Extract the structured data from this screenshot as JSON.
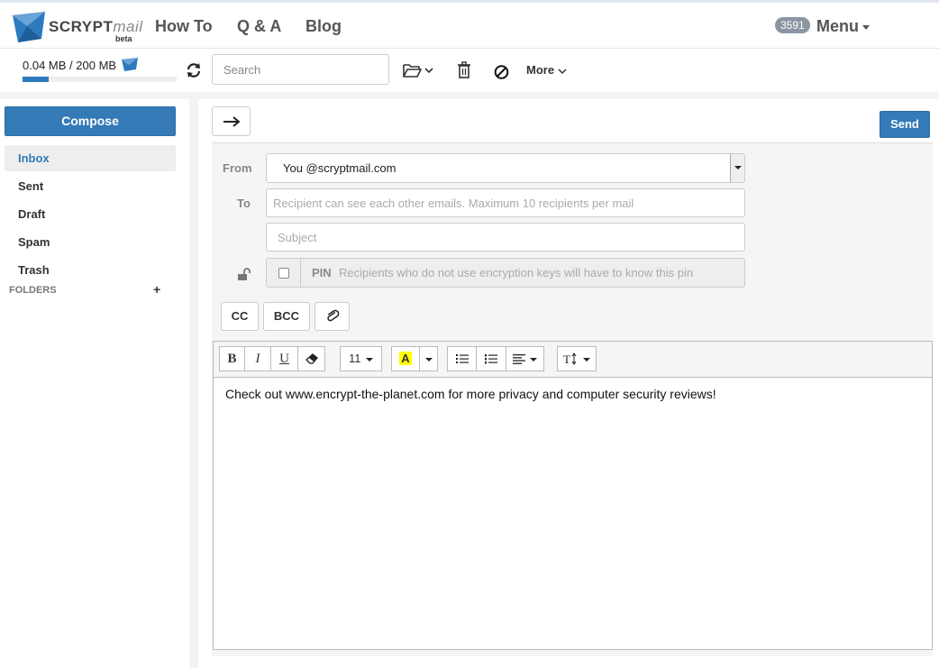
{
  "colors": {
    "primary": "#337ab7",
    "badge": "#8a96a2"
  },
  "nav": {
    "logo_main": "SCRYPT",
    "logo_mail": "mail",
    "logo_beta": "beta",
    "links": [
      "How To",
      "Q & A",
      "Blog"
    ],
    "badge_count": "3591",
    "menu_label": "Menu"
  },
  "toolbar": {
    "storage_used": "0.04 MB",
    "storage_total": "/ 200 MB",
    "storage_fraction": 0.17,
    "search_placeholder": "Search",
    "more_label": "More",
    "icons": [
      "refresh-icon",
      "folder-move-icon",
      "trash-icon",
      "block-icon"
    ]
  },
  "sidebar": {
    "compose_label": "Compose",
    "items": [
      {
        "label": "Inbox",
        "active": true
      },
      {
        "label": "Sent",
        "active": false
      },
      {
        "label": "Draft",
        "active": false
      },
      {
        "label": "Spam",
        "active": false
      },
      {
        "label": "Trash",
        "active": false
      }
    ],
    "folders_label": "FOLDERS",
    "folders_add": "+"
  },
  "compose": {
    "send_label": "Send",
    "from_label": "From",
    "from_value": "You @scryptmail.com",
    "to_label": "To",
    "to_placeholder": "Recipient can see each other emails. Maximum 10 recipients per mail",
    "subject_placeholder": "Subject",
    "pin_label": "PIN",
    "pin_placeholder": "Recipients who do not use encryption keys will have to know this pin",
    "cc_label": "CC",
    "bcc_label": "BCC"
  },
  "editor": {
    "bold": "B",
    "italic": "I",
    "underline": "U",
    "font_size": "11",
    "highlight": "A",
    "body_text": "Check out www.encrypt-the-planet.com for more privacy and computer security reviews!"
  }
}
